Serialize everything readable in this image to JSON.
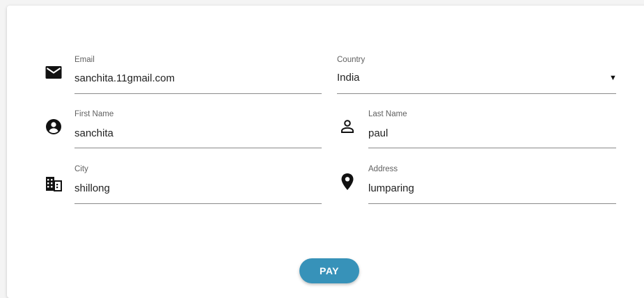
{
  "colors": {
    "accent": "#3792b9",
    "background": "#ffffff",
    "underline": "#8a8a8a"
  },
  "form": {
    "email": {
      "label": "Email",
      "value": "sanchita.11gmail.com",
      "icon": "email-icon"
    },
    "country": {
      "label": "Country",
      "selected": "India",
      "arrow": "▼"
    },
    "first_name": {
      "label": "First Name",
      "value": "sanchita",
      "icon": "account-circle-icon"
    },
    "last_name": {
      "label": "Last Name",
      "value": "paul",
      "icon": "person-outline-icon"
    },
    "city": {
      "label": "City",
      "value": "shillong",
      "icon": "building-icon"
    },
    "address": {
      "label": "Address",
      "value": "lumparing",
      "icon": "location-pin-icon"
    },
    "pay_label": "PAY"
  }
}
